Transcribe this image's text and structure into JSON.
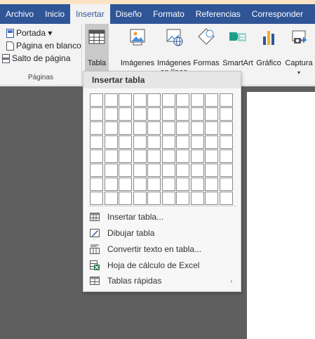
{
  "tabs": [
    "Archivo",
    "Inicio",
    "Insertar",
    "Diseño",
    "Formato",
    "Referencias",
    "Corresponder"
  ],
  "active_tab": "Insertar",
  "pages_group": {
    "items": [
      "Portada ▾",
      "Página en blanco",
      "Salto de página"
    ],
    "label": "Páginas"
  },
  "ribbon": {
    "tabla_line1": "Tabla",
    "tabla_arrow": "▾",
    "imagenes": "Imágenes",
    "imagenes_linea_1": "Imágenes",
    "imagenes_linea_2": "en línea",
    "formas": "Formas",
    "formas_arrow": "▾",
    "smartart": "SmartArt",
    "grafico": "Gráfico",
    "captura": "Captura",
    "captura_arrow": "▾"
  },
  "menu": {
    "title": "Insertar tabla",
    "items": [
      {
        "label": "Insertar tabla...",
        "icon": "insert-table-icon"
      },
      {
        "label": "Dibujar tabla",
        "icon": "draw-table-icon"
      },
      {
        "label": "Convertir texto en tabla...",
        "icon": "convert-text-icon"
      },
      {
        "label": "Hoja de cálculo de Excel",
        "icon": "excel-sheet-icon"
      },
      {
        "label": "Tablas rápidas",
        "icon": "quick-tables-icon",
        "submenu_arrow": "›"
      }
    ]
  },
  "colors": {
    "tabbar": "#2f5597",
    "excel_green": "#217346",
    "doc_background": "#5f5f5f"
  }
}
